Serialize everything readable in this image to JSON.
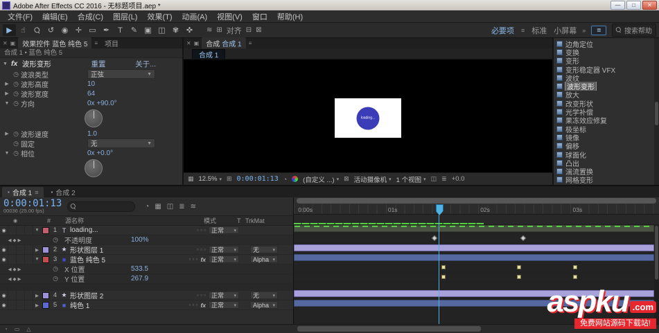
{
  "window": {
    "title": "Adobe After Effects CC 2016 - 无标题项目.aep *"
  },
  "menubar": {
    "items": [
      "文件(F)",
      "编辑(E)",
      "合成(C)",
      "图层(L)",
      "效果(T)",
      "动画(A)",
      "视图(V)",
      "窗口",
      "帮助(H)"
    ]
  },
  "toolbar": {
    "tools": [
      {
        "name": "selection-tool",
        "icon": "arrow"
      },
      {
        "name": "hand-tool",
        "icon": "hand"
      },
      {
        "name": "zoom-tool",
        "icon": "zoom"
      },
      {
        "name": "rotation-tool",
        "icon": "rotate"
      },
      {
        "name": "camera-tool",
        "icon": "camera"
      },
      {
        "name": "pan-behind-tool",
        "icon": "pan"
      },
      {
        "name": "shape-tool",
        "icon": "shape"
      },
      {
        "name": "pen-tool",
        "icon": "pen"
      },
      {
        "name": "type-tool",
        "icon": "type"
      },
      {
        "name": "brush-tool",
        "icon": "brush"
      },
      {
        "name": "clone-stamp-tool",
        "icon": "stamp"
      },
      {
        "name": "eraser-tool",
        "icon": "eraser"
      },
      {
        "name": "roto-brush-tool",
        "icon": "roto"
      },
      {
        "name": "puppet-pin-tool",
        "icon": "puppet"
      }
    ],
    "align_label": "对齐",
    "workspaces": [
      "必要项",
      "标准",
      "小屏幕"
    ],
    "active_workspace": "必要项",
    "overflow_label": "»",
    "search_label": "搜索帮助"
  },
  "effect_controls": {
    "tab_title": "效果控件",
    "tab_target": "蓝色 纯色 5",
    "tab_project": "项目",
    "breadcrumb": "合成 1 • 蓝色 纯色 5",
    "effect": {
      "name": "波形变形",
      "reset_label": "重置",
      "about_label": "关于...",
      "properties": [
        {
          "name": "波浪类型",
          "type": "dropdown",
          "value": "正弦"
        },
        {
          "name": "波形高度",
          "type": "value",
          "value": "10"
        },
        {
          "name": "波形宽度",
          "type": "value",
          "value": "64"
        },
        {
          "name": "方向",
          "type": "dial",
          "value": "0x +90.0°"
        },
        {
          "name": "波形速度",
          "type": "value",
          "value": "1.0"
        },
        {
          "name": "固定",
          "type": "dropdown",
          "value": "无"
        },
        {
          "name": "相位",
          "type": "dial",
          "value": "0x +0.0°"
        }
      ]
    }
  },
  "composition": {
    "tab_panel": "合成",
    "tab_comp": "合成 1",
    "inner_tab": "合成 1",
    "loading_text": "loading...",
    "status": {
      "zoom": "12.5%",
      "timecode": "0:00:01:13",
      "colorspace": "(自定义 ...)",
      "camera": "活动摄像机",
      "views": "1 个视图",
      "exposure": "+0.0"
    }
  },
  "effects_panel": {
    "items": [
      "边角定位",
      "变换",
      "变形",
      "变形稳定器 VFX",
      "波纹",
      "波形变形",
      "放大",
      "改变形状",
      "光学补偿",
      "果冻效应修复",
      "极坐标",
      "镜像",
      "偏移",
      "球面化",
      "凸出",
      "湍流置换",
      "网格变形"
    ],
    "selected": "波形变形"
  },
  "timeline": {
    "tabs": [
      {
        "label": "合成 1",
        "active": true
      },
      {
        "label": "合成 2",
        "active": false
      }
    ],
    "timecode": "0:00:01:13",
    "frame_info": "00036 (25.00 fps)",
    "columns": {
      "num": "#",
      "source": "源名称",
      "mode": "模式",
      "t": "T",
      "trkmat": "TrkMat"
    },
    "ruler": [
      {
        "label": "0:00s",
        "pos": 0.8
      },
      {
        "label": "01s",
        "pos": 25.4
      },
      {
        "label": "02s",
        "pos": 50.7
      },
      {
        "label": "03s",
        "pos": 76.0
      }
    ],
    "playhead_pos": 39.6,
    "rows": [
      {
        "type": "layer",
        "num": "1",
        "name": "loading...",
        "icon": "text",
        "label_color": "#c0606e",
        "mode": "正常",
        "trkmat": "",
        "bar": "loading",
        "expanded": true
      },
      {
        "type": "prop",
        "name": "不透明度",
        "value": "100%",
        "keys": [
          38.5,
          63.0
        ],
        "key_style": "diamond"
      },
      {
        "type": "layer",
        "num": "2",
        "name": "形状图层 1",
        "icon": "star",
        "label_color": "#9c92d8",
        "mode": "正常",
        "trkmat": "无",
        "bar": "lavender",
        "expanded": false
      },
      {
        "type": "layer",
        "num": "3",
        "name": "蓝色 纯色 5",
        "icon": "solid",
        "icon_color": "#3d4ec4",
        "label_color": "#c05050",
        "mode": "正常",
        "trkmat": "Alpha",
        "bar": "steel",
        "fx": true,
        "expanded": true
      },
      {
        "type": "prop",
        "name": "X 位置",
        "value": "533.5",
        "keys": [
          41.0,
          62.0,
          77.5
        ],
        "key_style": "square"
      },
      {
        "type": "prop",
        "name": "Y 位置",
        "value": "267.9",
        "keys": [
          41.0,
          62.0,
          77.5
        ],
        "key_style": "square"
      },
      {
        "type": "spacer"
      },
      {
        "type": "layer",
        "num": "4",
        "name": "形状图层 2",
        "icon": "star",
        "label_color": "#9c92d8",
        "mode": "正常",
        "trkmat": "无",
        "bar": "lavender",
        "expanded": false
      },
      {
        "type": "layer",
        "num": "5",
        "name": "纯色 1",
        "icon": "solid",
        "icon_color": "#4a5fd0",
        "label_color": "#5a6ad0",
        "mode": "正常",
        "trkmat": "Alpha",
        "bar": "steel",
        "fx": true,
        "expanded": false
      }
    ]
  },
  "colors": {
    "accent_blue": "#7ab4f5",
    "value_blue": "#8ab0de",
    "bar_lavender": "#a9a1d9",
    "bar_steel": "#55689f",
    "bar_loading": "#4a5244",
    "cache_green": "#56cf45",
    "solid_blue": "#3b3db8",
    "keyframe_yellow": "#e6e0a0",
    "keyframe_gray": "#d0d0d0",
    "playhead_blue": "#4db3e6",
    "watermark_red": "#e8262d"
  },
  "watermark": {
    "brand": "aspku",
    "suffix": ".com",
    "tagline": "免费网站源码下载站!"
  }
}
